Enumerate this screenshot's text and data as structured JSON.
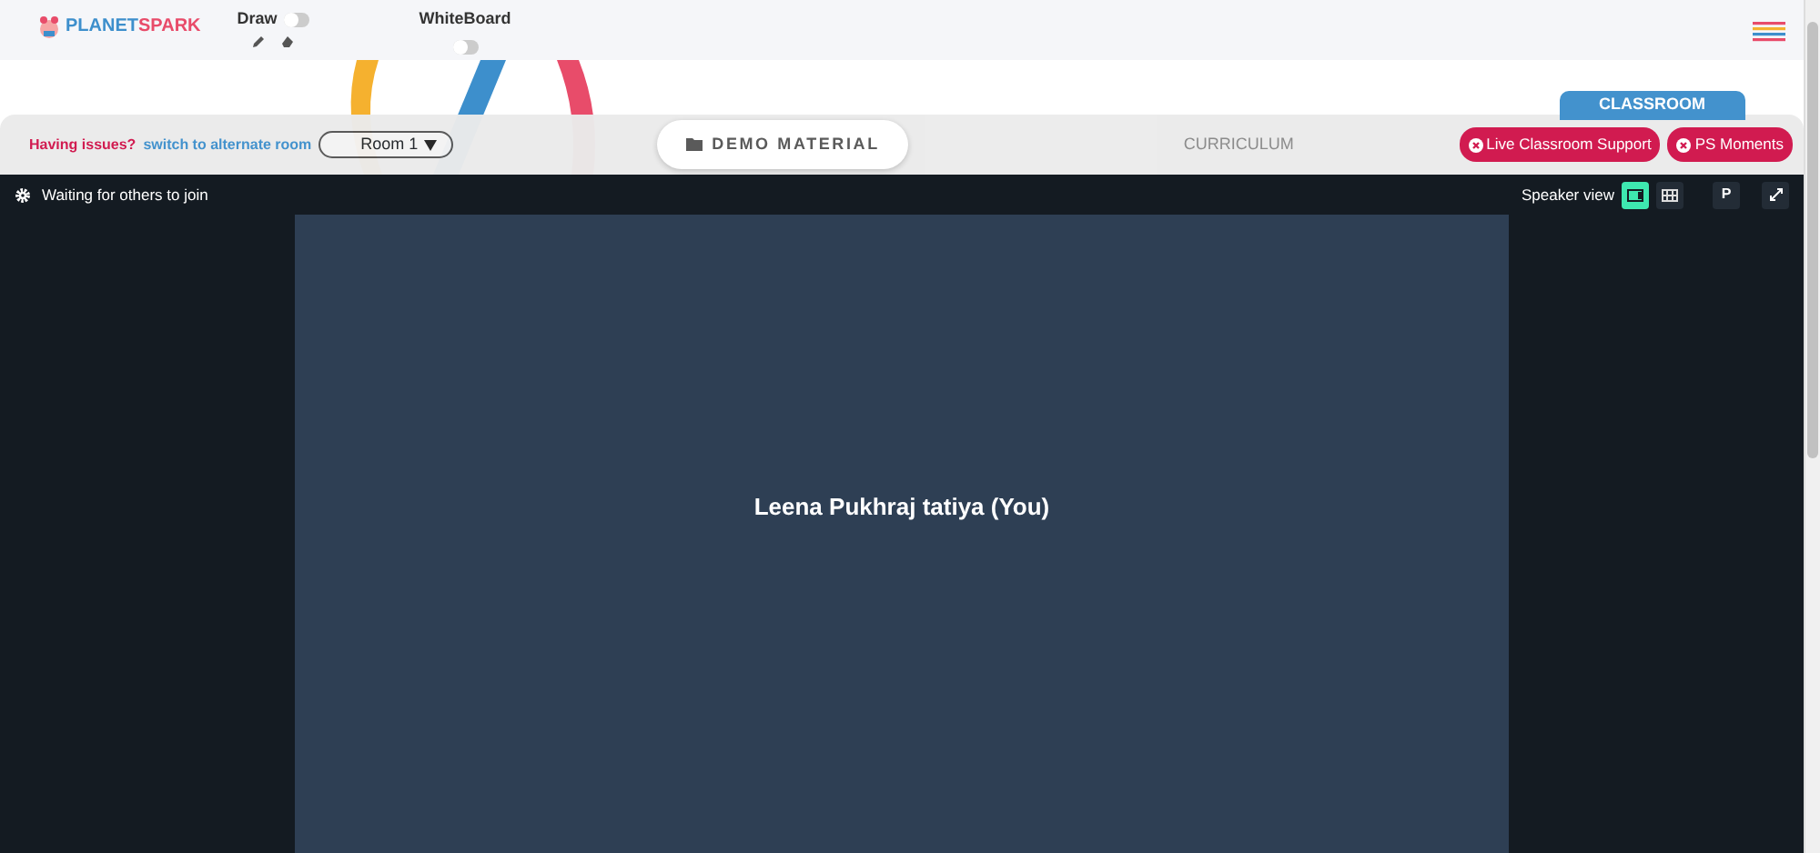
{
  "header": {
    "logo": {
      "first": "PLANET",
      "second": "SPARK"
    },
    "toggles": [
      {
        "label": "Draw",
        "on": false,
        "tools": true
      },
      {
        "label": "WhiteBoard",
        "on": false,
        "tools": false
      }
    ]
  },
  "toolbar": {
    "issue_text": "Having issues?",
    "switch_link": "switch to alternate room",
    "room": "Room 1",
    "tabs": [
      {
        "label": "DEMO MATERIAL",
        "selected": true
      },
      {
        "label": "CURRICULUM",
        "selected": false
      }
    ],
    "classroom_tab": "CLASSROOM",
    "support_buttons": [
      "Live Classroom Support",
      "PS Moments"
    ]
  },
  "meeting": {
    "status": "Waiting for others to join",
    "view_label": "Speaker view",
    "views": [
      {
        "kind": "speaker",
        "selected": true
      },
      {
        "kind": "gallery",
        "selected": false
      }
    ],
    "p_button": "P",
    "participant": "Leena Pukhraj tatiya (You)"
  }
}
